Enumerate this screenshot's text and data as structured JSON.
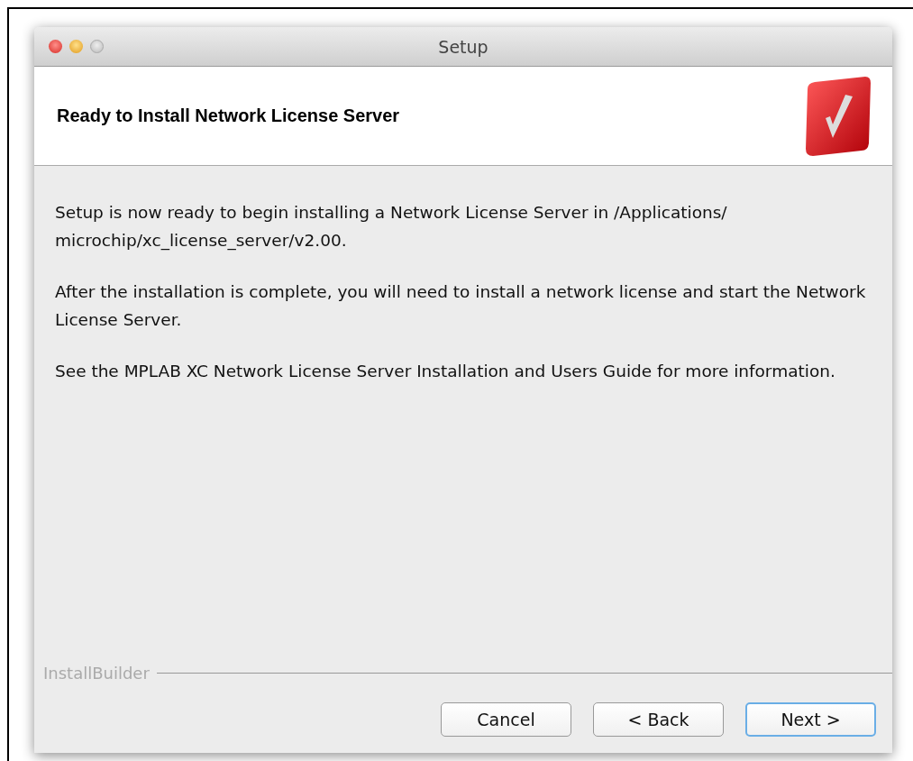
{
  "window": {
    "title": "Setup"
  },
  "header": {
    "title": "Ready to Install Network License Server"
  },
  "paragraphs": [
    "Setup is now ready to begin installing a Network License Server in /Applications/ microchip/xc_license_server/v2.00.",
    "After the installation is complete, you will need to install a network license and start the Network License Server.",
    "See the MPLAB XC Network License Server Installation and Users Guide for more information."
  ],
  "footer": {
    "brand": "InstallBuilder"
  },
  "buttons": [
    {
      "label": "Cancel",
      "default": false
    },
    {
      "label": "< Back",
      "default": false
    },
    {
      "label": "Next >",
      "default": true
    }
  ]
}
